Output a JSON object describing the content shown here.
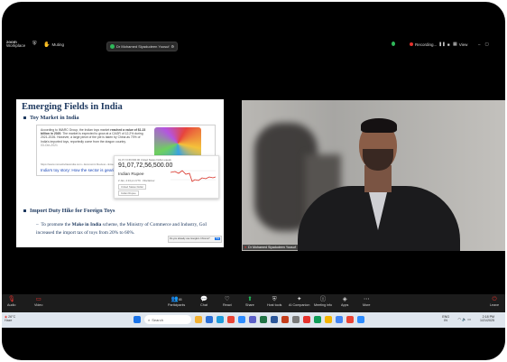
{
  "zoom": {
    "logo": {
      "line1": "zoom",
      "line2": "Workplace"
    },
    "muted_label": "Muting",
    "participant_pill": "Dr Mohamed Siyadudeen Yoosuf",
    "recording_label": "Recording...",
    "view_label": "View"
  },
  "slide": {
    "title": "Emerging Fields in India",
    "bullet1": "Toy Market in India",
    "snippet": {
      "text_before": "According to IMARC Group, the Indian toys market ",
      "text_bold": "reached a value of $1.23 billion in 2020",
      "text_after": ". The market is expected to grow at a CAGR of 12.2% during 2021-2026. However, a large piece of the pie is taken by China as 70% of India's imported toys, reportedly come from the dragon country.",
      "date": "03-Oct-2021",
      "source": "https://www.mmactivitiesindia.com › Economic Review › Emerging Sector",
      "link": "India's toy story: How the sector is gearing up for..."
    },
    "currency": {
      "header": "91,07,72,56,500.00 United States Dollar equals",
      "value": "91,07,72,56,500",
      "decimals": ".00",
      "unit": "Indian Rupee",
      "disclaimer": "2 Jan, 4:13 pm UTC · Disclaimer",
      "from_label": "United States Dollar",
      "to_label": "Indian Rupee"
    },
    "toast": {
      "text": "Do you already use Google's Chrome?",
      "button": "Yes"
    },
    "bullet2": "Import Duty Hike for Foreign Toys",
    "body_prefix": "To promote the ",
    "body_bold": "Make in India",
    "body_suffix": " scheme, the Ministry of Commerce and Industry, GoI increased the import tax of toys from 20% to 60%."
  },
  "video": {
    "name_label": "Dr Mohamed Siyadudeen Yoosuf"
  },
  "controls": {
    "audio": "Audio",
    "video": "Video",
    "participants": "Participants",
    "participants_count": "65",
    "chat": "Chat",
    "react": "React",
    "share": "Share",
    "host_tools": "Host tools",
    "ai_companion": "AI Companion",
    "meeting_info": "Meeting info",
    "apps": "Apps",
    "more": "More",
    "leave": "Leave"
  },
  "taskbar": {
    "weather_temp": "26°C",
    "weather_desc": "Haze",
    "search_placeholder": "Search",
    "lang1": "ENG",
    "lang2": "IN",
    "time": "2:18 PM",
    "date": "1/21/2025"
  },
  "colors": {
    "slide_title": "#1f3a60",
    "link": "#1a47b8",
    "share_green": "#22c55e",
    "record_red": "#e5322d",
    "leave_red": "#e5322d",
    "taskbar": "#dfe6ee"
  }
}
